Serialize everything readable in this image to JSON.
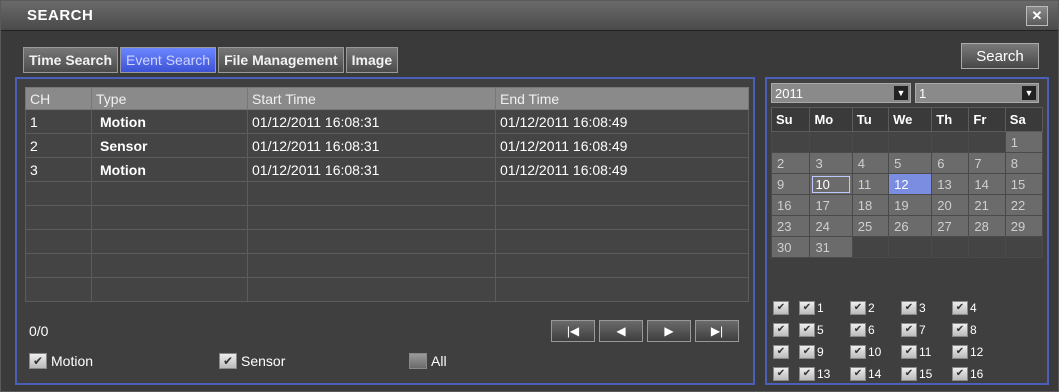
{
  "window": {
    "title": "SEARCH",
    "close_label": "✕"
  },
  "tabs": [
    {
      "label": "Time Search"
    },
    {
      "label": "Event Search"
    },
    {
      "label": "File Management"
    },
    {
      "label": "Image"
    }
  ],
  "search_button": "Search",
  "events": {
    "columns": [
      "CH",
      "Type",
      "Start Time",
      "End Time"
    ],
    "rows": [
      {
        "ch": "1",
        "type": "Motion",
        "start": "01/12/2011 16:08:31",
        "end": "01/12/2011 16:08:49"
      },
      {
        "ch": "2",
        "type": "Sensor",
        "start": "01/12/2011 16:08:31",
        "end": "01/12/2011 16:08:49"
      },
      {
        "ch": "3",
        "type": "Motion",
        "start": "01/12/2011 16:08:31",
        "end": "01/12/2011 16:08:49"
      }
    ],
    "empty_rows": 5,
    "pager_text": "0/0",
    "pager_icons": [
      "first-page-icon",
      "prev-page-icon",
      "next-page-icon",
      "last-page-icon"
    ]
  },
  "filters": [
    {
      "label": "Motion",
      "checked": true
    },
    {
      "label": "Sensor",
      "checked": true
    },
    {
      "label": "All",
      "checked": false
    }
  ],
  "calendar": {
    "year": "2011",
    "month": "1",
    "weekdays": [
      "Su",
      "Mo",
      "Tu",
      "We",
      "Th",
      "Fr",
      "Sa"
    ],
    "weeks": [
      [
        "",
        "",
        "",
        "",
        "",
        "",
        "1"
      ],
      [
        "2",
        "3",
        "4",
        "5",
        "6",
        "7",
        "8"
      ],
      [
        "9",
        "10",
        "11",
        "12",
        "13",
        "14",
        "15"
      ],
      [
        "16",
        "17",
        "18",
        "19",
        "20",
        "21",
        "22"
      ],
      [
        "23",
        "24",
        "25",
        "26",
        "27",
        "28",
        "29"
      ],
      [
        "30",
        "31",
        "",
        "",
        "",
        "",
        ""
      ]
    ],
    "selected_day": "12",
    "today": "10"
  },
  "channels": {
    "rows": [
      [
        "1",
        "2",
        "3",
        "4"
      ],
      [
        "5",
        "6",
        "7",
        "8"
      ],
      [
        "9",
        "10",
        "11",
        "12"
      ],
      [
        "13",
        "14",
        "15",
        "16"
      ]
    ]
  },
  "colors": {
    "accent": "#4a5fb8",
    "active_tab": "#5068e8",
    "selected_day": "#7a8de0"
  }
}
